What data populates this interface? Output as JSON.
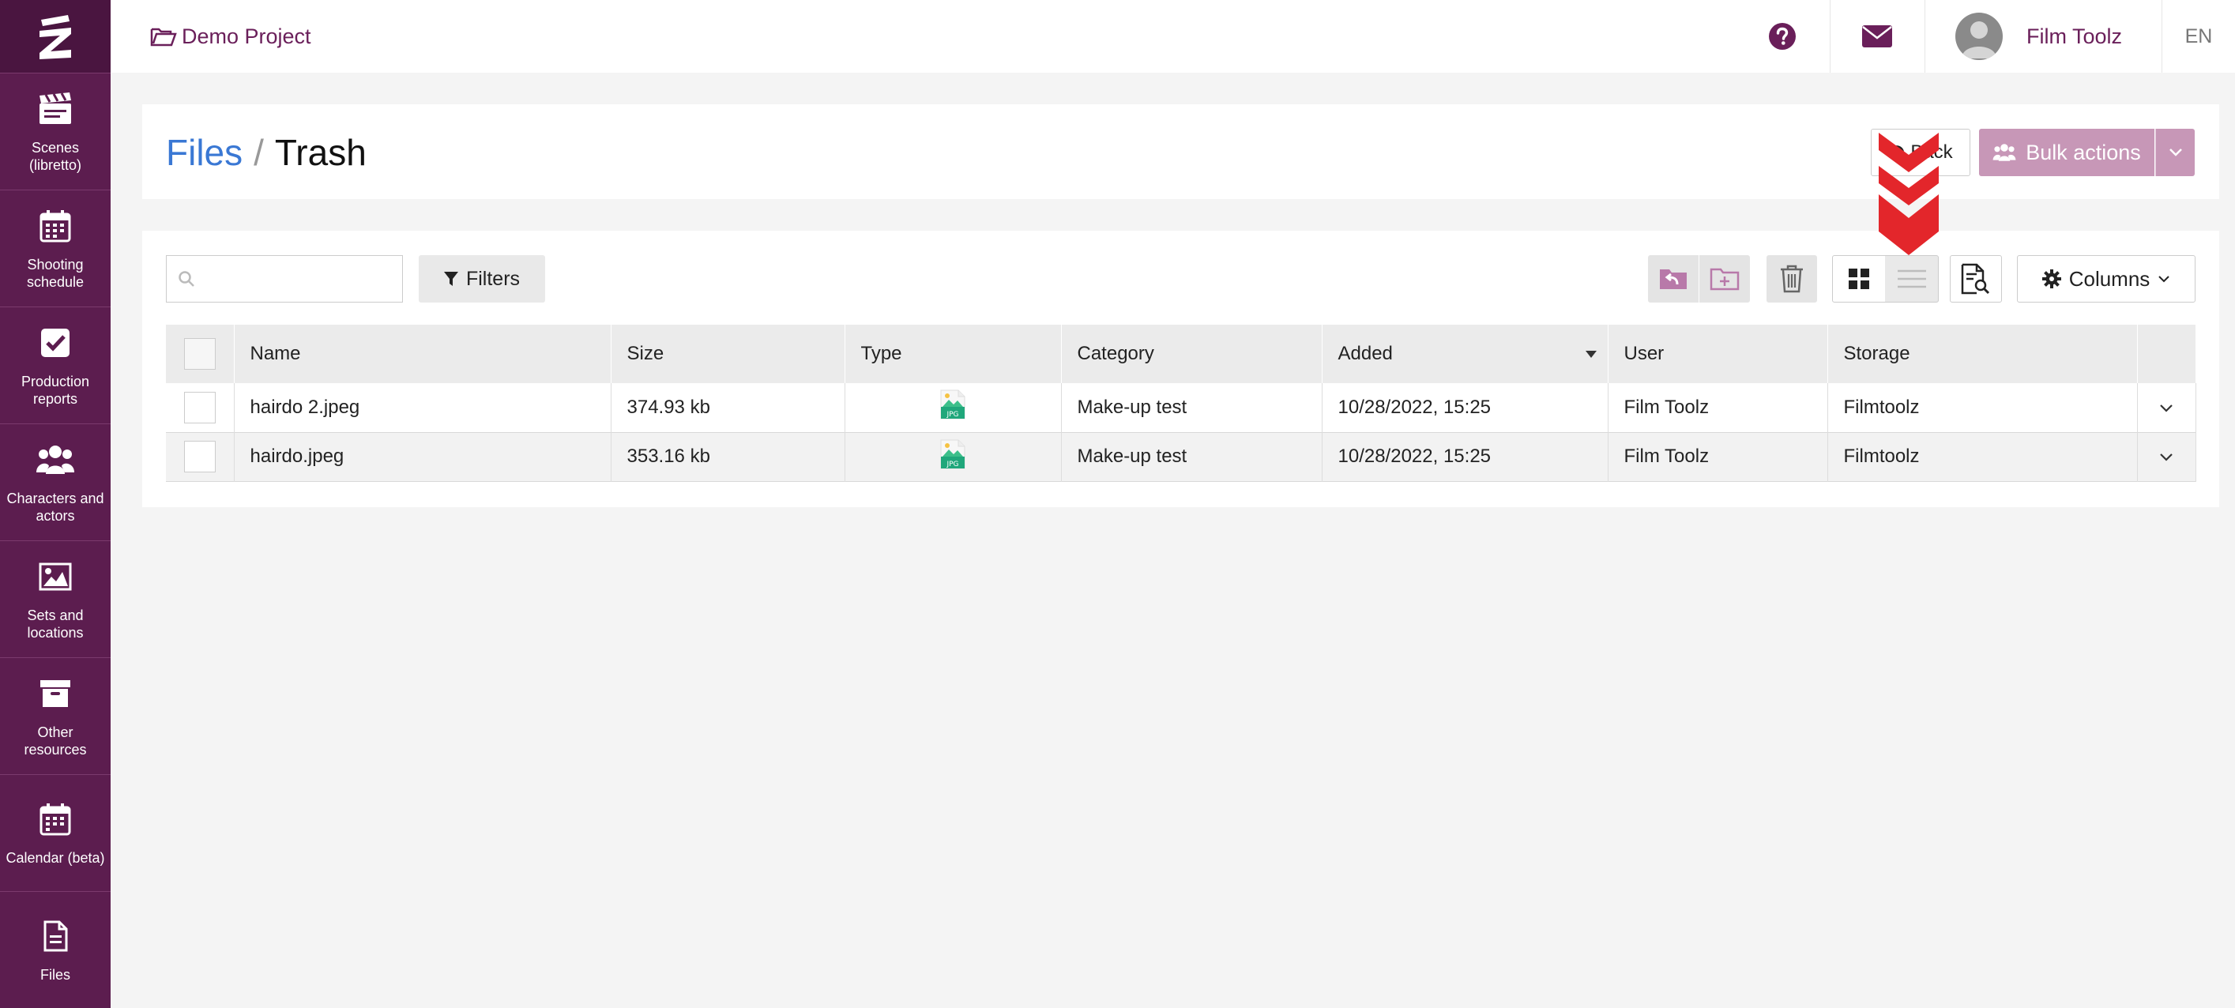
{
  "sidebar": {
    "items": [
      {
        "label": "Scenes (libretto)",
        "icon": "clapperboard-icon"
      },
      {
        "label": "Shooting schedule",
        "icon": "calendar-grid-icon"
      },
      {
        "label": "Production reports",
        "icon": "checkbox-icon"
      },
      {
        "label": "Characters and actors",
        "icon": "users-icon"
      },
      {
        "label": "Sets and locations",
        "icon": "image-icon"
      },
      {
        "label": "Other resources",
        "icon": "archive-box-icon"
      },
      {
        "label": "Calendar (beta)",
        "icon": "calendar-icon"
      },
      {
        "label": "Files",
        "icon": "file-icon"
      }
    ]
  },
  "topbar": {
    "project": "Demo Project",
    "user_name": "Film Toolz",
    "language": "EN"
  },
  "header": {
    "crumb_files": "Files",
    "crumb_sep": "/",
    "crumb_trash": "Trash",
    "back_label": "Back",
    "bulk_label": "Bulk actions"
  },
  "toolbar": {
    "search_placeholder": "",
    "filters_label": "Filters",
    "columns_label": "Columns"
  },
  "table": {
    "headers": {
      "name": "Name",
      "size": "Size",
      "type": "Type",
      "category": "Category",
      "added": "Added",
      "user": "User",
      "storage": "Storage"
    },
    "rows": [
      {
        "name": "hairdo 2.jpeg",
        "size": "374.93 kb",
        "type": "JPG",
        "category": "Make-up test",
        "added": "10/28/2022, 15:25",
        "user": "Film Toolz",
        "storage": "Filmtoolz"
      },
      {
        "name": "hairdo.jpeg",
        "size": "353.16 kb",
        "type": "JPG",
        "category": "Make-up test",
        "added": "10/28/2022, 15:25",
        "user": "Film Toolz",
        "storage": "Filmtoolz"
      }
    ]
  },
  "colors": {
    "brand": "#5c1d4f",
    "accent": "#6a1f5a",
    "link": "#3a78d4",
    "bulk": "#c797b7",
    "hint_arrow": "#e3262b"
  }
}
